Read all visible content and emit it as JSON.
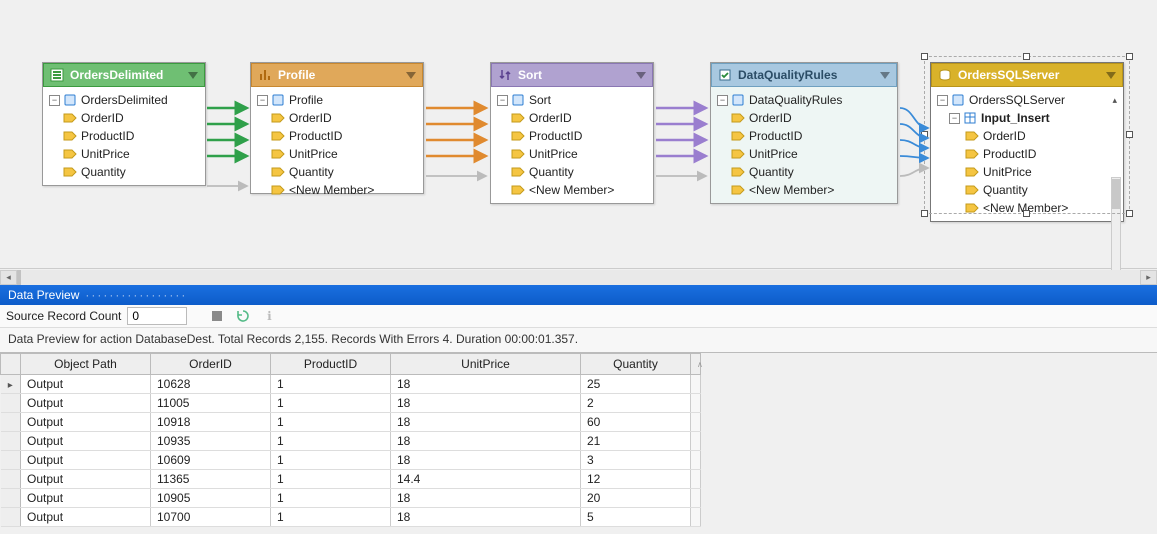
{
  "nodes": {
    "ordersDelimited": {
      "title": "OrdersDelimited",
      "root": "OrdersDelimited",
      "members": [
        "OrderID",
        "ProductID",
        "UnitPrice",
        "Quantity"
      ]
    },
    "profile": {
      "title": "Profile",
      "root": "Profile",
      "members": [
        "OrderID",
        "ProductID",
        "UnitPrice",
        "Quantity",
        "<New Member>"
      ]
    },
    "sort": {
      "title": "Sort",
      "root": "Sort",
      "members": [
        "OrderID",
        "ProductID",
        "UnitPrice",
        "Quantity",
        "<New Member>"
      ]
    },
    "dq": {
      "title": "DataQualityRules",
      "root": "DataQualityRules",
      "members": [
        "OrderID",
        "ProductID",
        "UnitPrice",
        "Quantity",
        "<New Member>"
      ]
    },
    "ordersSql": {
      "title": "OrdersSQLServer",
      "root": "OrdersSQLServer",
      "input": "Input_Insert",
      "members": [
        "OrderID",
        "ProductID",
        "UnitPrice",
        "Quantity",
        "<New Member>"
      ]
    }
  },
  "preview": {
    "panel_title": "Data Preview",
    "source_label": "Source Record Count",
    "source_value": "0",
    "summary": "Data Preview for action DatabaseDest. Total Records 2,155. Records With Errors 4. Duration 00:00:01.357.",
    "columns": [
      "Object Path",
      "OrderID",
      "ProductID",
      "UnitPrice",
      "Quantity"
    ],
    "rows": [
      [
        "Output",
        "10628",
        "1",
        "18",
        "25"
      ],
      [
        "Output",
        "11005",
        "1",
        "18",
        "2"
      ],
      [
        "Output",
        "10918",
        "1",
        "18",
        "60"
      ],
      [
        "Output",
        "10935",
        "1",
        "18",
        "21"
      ],
      [
        "Output",
        "10609",
        "1",
        "18",
        "3"
      ],
      [
        "Output",
        "11365",
        "1",
        "14.4",
        "12"
      ],
      [
        "Output",
        "10905",
        "1",
        "18",
        "20"
      ],
      [
        "Output",
        "10700",
        "1",
        "18",
        "5"
      ]
    ]
  }
}
